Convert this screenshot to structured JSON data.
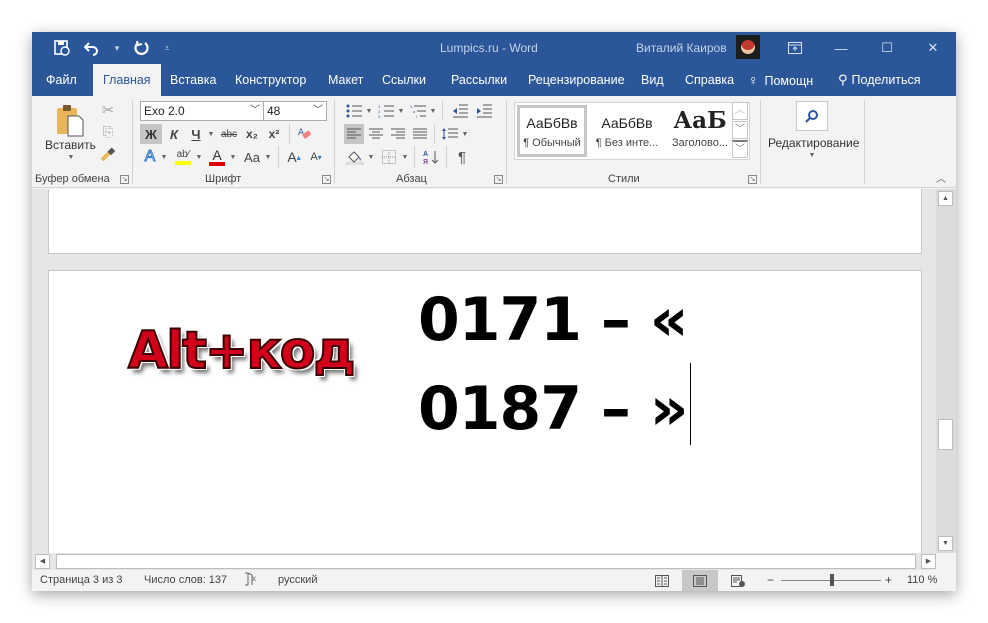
{
  "titlebar": {
    "document_title": "Lumpics.ru  -  Word",
    "user_name": "Виталий Каиров",
    "qat": {
      "autosave_icon": "save-sync-icon",
      "undo_icon": "undo-icon",
      "redo_icon": "redo-icon",
      "customize_icon": "customize-qat-icon"
    },
    "window_buttons": {
      "ribbon_display": "▣",
      "minimize": "—",
      "maximize": "☐",
      "close": "✕"
    }
  },
  "tabs": [
    {
      "label": "Файл",
      "active": false
    },
    {
      "label": "Главная",
      "active": true
    },
    {
      "label": "Вставка",
      "active": false
    },
    {
      "label": "Конструктор",
      "active": false
    },
    {
      "label": "Макет",
      "active": false
    },
    {
      "label": "Ссылки",
      "active": false
    },
    {
      "label": "Рассылки",
      "active": false
    },
    {
      "label": "Рецензирование",
      "active": false
    },
    {
      "label": "Вид",
      "active": false
    },
    {
      "label": "Справка",
      "active": false
    }
  ],
  "tell_me": {
    "label": "Помощн",
    "icon": "lightbulb-icon"
  },
  "share": {
    "label": "Поделиться",
    "icon": "person-add-icon"
  },
  "ribbon": {
    "clipboard": {
      "label": "Буфер обмена",
      "paste_label": "Вставить"
    },
    "font": {
      "label": "Шрифт",
      "font_name": "Exo 2.0",
      "font_size": "48",
      "bold": "Ж",
      "italic": "К",
      "underline": "Ч",
      "strikethrough": "abc",
      "subscript": "x₂",
      "superscript": "x²",
      "change_case": "Aa",
      "grow": "A",
      "shrink": "A",
      "highlight_color": "#ffff00",
      "font_color": "#e00000"
    },
    "paragraph": {
      "label": "Абзац",
      "pilcrow": "¶"
    },
    "styles": {
      "label": "Стили",
      "items": [
        {
          "preview": "АаБбВв",
          "name": "¶ Обычный",
          "selected": true
        },
        {
          "preview": "АаБбВв",
          "name": "¶ Без инте...",
          "selected": false
        },
        {
          "preview": "АаБ",
          "name": "Заголово...",
          "selected": false
        }
      ]
    },
    "editing": {
      "label": "Редактирование"
    }
  },
  "document": {
    "logo_text": "Alt+код",
    "lines": [
      "0171 – «",
      "0187 – »"
    ]
  },
  "statusbar": {
    "page": "Страница 3 из 3",
    "word_count": "Число слов: 137",
    "language": "русский",
    "zoom_minus": "−",
    "zoom_plus": "+",
    "zoom_level": "110 %",
    "zoom_percent": 110
  }
}
